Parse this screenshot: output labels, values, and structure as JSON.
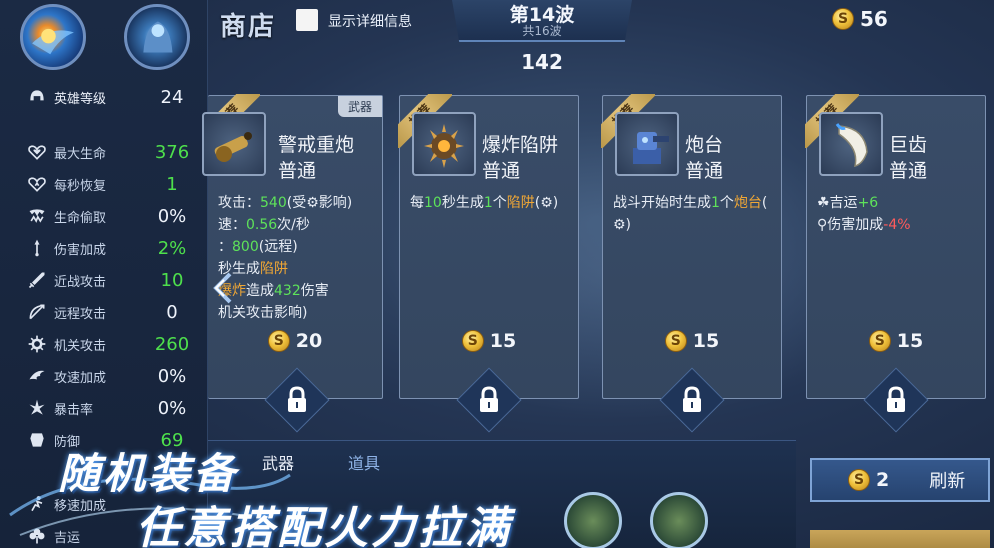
{
  "header": {
    "title": "商店",
    "detail_toggle_label": "显示详细信息",
    "wave_title": "第14波",
    "wave_total": "共16波",
    "timer": "142",
    "gold": "56",
    "coin_symbol": "S"
  },
  "stats": [
    {
      "icon": "helmet-icon",
      "label": "英雄等级",
      "value": "24",
      "color": "white"
    },
    {
      "icon": "heart-icon",
      "label": "最大生命",
      "value": "376",
      "color": "green"
    },
    {
      "icon": "heart-regen-icon",
      "label": "每秒恢复",
      "value": "1",
      "color": "green"
    },
    {
      "icon": "fang-icon",
      "label": "生命偷取",
      "value": "0%",
      "color": "white"
    },
    {
      "icon": "damage-icon",
      "label": "伤害加成",
      "value": "2%",
      "color": "green"
    },
    {
      "icon": "sword-icon",
      "label": "近战攻击",
      "value": "10",
      "color": "green"
    },
    {
      "icon": "bow-icon",
      "label": "远程攻击",
      "value": "0",
      "color": "white"
    },
    {
      "icon": "gear-icon",
      "label": "机关攻击",
      "value": "260",
      "color": "green"
    },
    {
      "icon": "wing-icon",
      "label": "攻速加成",
      "value": "0%",
      "color": "white"
    },
    {
      "icon": "crit-icon",
      "label": "暴击率",
      "value": "0%",
      "color": "white"
    },
    {
      "icon": "armor-icon",
      "label": "防御",
      "value": "69",
      "color": "green"
    },
    {
      "icon": "dodge-icon",
      "label": "移速加成",
      "value": "",
      "color": "white"
    },
    {
      "icon": "clover-icon",
      "label": "吉运",
      "value": "",
      "color": "white"
    }
  ],
  "cards": [
    {
      "ribbon": "推荐",
      "tag": "武器",
      "icon": "cannon-icon",
      "name": "警戒重炮",
      "rarity": "普通",
      "price": "20",
      "desc": [
        [
          {
            "t": "攻击："
          },
          {
            "t": "540",
            "c": "g"
          },
          {
            "t": "(受"
          },
          {
            "t": "⚙",
            "c": ""
          },
          {
            "t": "影响)"
          }
        ],
        [
          {
            "t": "速："
          },
          {
            "t": "0.56",
            "c": "g"
          },
          {
            "t": "次/秒"
          }
        ],
        [
          {
            "t": "："
          },
          {
            "t": "800",
            "c": "g"
          },
          {
            "t": "(远程)"
          }
        ],
        [
          {
            "t": "秒生成"
          },
          {
            "t": "陷阱",
            "c": "o"
          }
        ],
        [
          {
            "t": "爆炸",
            "c": "o"
          },
          {
            "t": "造成"
          },
          {
            "t": "432",
            "c": "g"
          },
          {
            "t": "伤害"
          }
        ],
        [
          {
            "t": "机关攻击影响)"
          }
        ]
      ]
    },
    {
      "ribbon": "推荐",
      "tag": "",
      "icon": "spiked-bomb-icon",
      "name": "爆炸陷阱",
      "rarity": "普通",
      "price": "15",
      "desc": [
        [
          {
            "t": "每"
          },
          {
            "t": "10",
            "c": "g"
          },
          {
            "t": "秒生成"
          },
          {
            "t": "1",
            "c": "g"
          },
          {
            "t": "个"
          },
          {
            "t": "陷阱",
            "c": "o"
          },
          {
            "t": "(⚙)"
          }
        ]
      ]
    },
    {
      "ribbon": "推荐",
      "tag": "",
      "icon": "turret-icon",
      "name": "炮台",
      "rarity": "普通",
      "price": "15",
      "desc": [
        [
          {
            "t": "战斗开始时生成"
          },
          {
            "t": "1",
            "c": "g"
          },
          {
            "t": "个"
          },
          {
            "t": "炮台",
            "c": "o"
          },
          {
            "t": "("
          }
        ],
        [
          {
            "t": "⚙)"
          }
        ]
      ]
    },
    {
      "ribbon": "推荐",
      "tag": "",
      "icon": "fang-item-icon",
      "name": "巨齿",
      "rarity": "普通",
      "price": "15",
      "desc": [
        [
          {
            "t": "☘吉运"
          },
          {
            "t": "+6",
            "c": "g"
          }
        ],
        [
          {
            "t": "⚲伤害加成"
          },
          {
            "t": "-4%",
            "c": "r"
          }
        ]
      ]
    }
  ],
  "bottom": {
    "tab_weapon": "武器",
    "tab_item": "道具",
    "promo_line1": "随机装备",
    "promo_line2": "任意搭配火力拉满",
    "refresh_cost": "2",
    "refresh_label": "刷新"
  }
}
